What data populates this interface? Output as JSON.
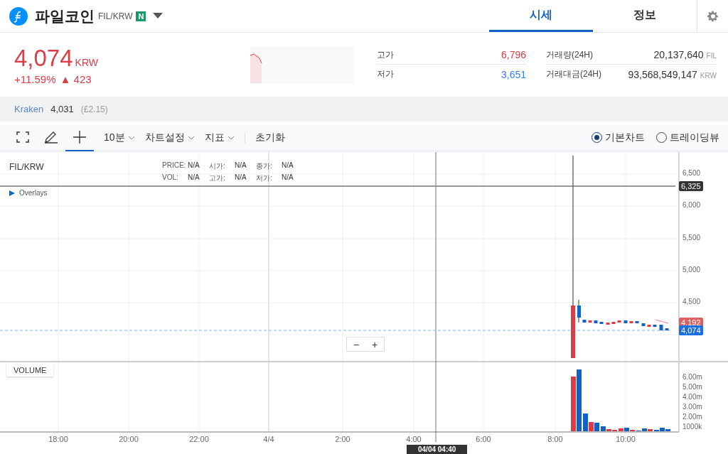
{
  "header": {
    "coin_name": "파일코인",
    "pair": "FIL/KRW",
    "badge": "N"
  },
  "tabs": [
    {
      "label": "시세",
      "selected": true
    },
    {
      "label": "정보",
      "selected": false
    }
  ],
  "price": {
    "value": "4,074",
    "unit": "KRW",
    "change_pct": "+11.59%",
    "change_arrow": "▲",
    "change_abs": "423"
  },
  "stats": [
    {
      "label": "고가",
      "value": "6,796",
      "kind": "high"
    },
    {
      "label": "거래량(24H)",
      "value": "20,137,640",
      "unit": "FIL",
      "kind": "plain"
    },
    {
      "label": "저가",
      "value": "3,651",
      "kind": "low"
    },
    {
      "label": "거래대금(24H)",
      "value": "93,568,549,147",
      "unit": "KRW",
      "kind": "plain"
    }
  ],
  "exchange": {
    "name": "Kraken",
    "price": "4,031",
    "sub": "(£2.15)"
  },
  "toolbar": {
    "tools": [
      {
        "selected": false
      },
      {
        "selected": false
      },
      {
        "selected": true
      }
    ],
    "menus": [
      {
        "label": "10분",
        "kind": "dropdown"
      },
      {
        "label": "차트설정",
        "kind": "dropdown"
      },
      {
        "label": "지표",
        "kind": "dropdown"
      },
      {
        "label": "초기화",
        "kind": "button"
      }
    ],
    "chart_types": [
      {
        "label": "기본차트",
        "selected": true
      },
      {
        "label": "트레이딩뷰",
        "selected": false
      }
    ]
  },
  "chart": {
    "symbol": "FIL/KRW",
    "overlays": "Overlays",
    "info": [
      {
        "label": "PRICE:",
        "value": "N/A"
      },
      {
        "label": "시가:",
        "value": "N/A"
      },
      {
        "label": "종가:",
        "value": "N/A"
      },
      {
        "label": "VOL:",
        "value": "N/A"
      },
      {
        "label": "고가:",
        "value": "N/A"
      },
      {
        "label": "저가:",
        "value": "N/A"
      }
    ],
    "y_ticks": [
      "6,500",
      "6,000",
      "5,500",
      "5,000",
      "4,500"
    ],
    "crosshair_price": "6,325",
    "high_tag": "4,192",
    "last_tag": "4,074",
    "zoom_buttons": [
      "−",
      "+"
    ],
    "volume_label": "VOLUME",
    "volume_ticks": [
      "6.00m",
      "5.00m",
      "4.00m",
      "3.00m",
      "2.00m",
      "1000k"
    ],
    "x_ticks": [
      "18:00",
      "20:00",
      "22:00",
      "4/4",
      "2:00",
      "4:00",
      "6:00",
      "8:00",
      "10:00"
    ],
    "crosshair_time": "04/04 04:40"
  }
}
